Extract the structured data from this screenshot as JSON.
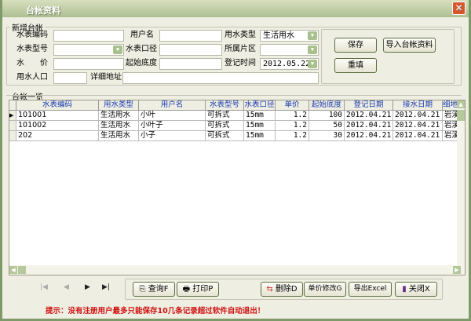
{
  "window": {
    "title": "台帐资料",
    "close": "✕"
  },
  "form": {
    "group_label": "新增台帐",
    "labels": {
      "meter_code": "水表编码",
      "username": "用户名",
      "water_type": "用水类型",
      "meter_model": "水表型号",
      "meter_caliber": "水表口径",
      "area": "所属片区",
      "price": "水　　价",
      "start_reading": "起始底度",
      "reg_time": "登记时间",
      "population": "用水人口",
      "address": "详细地址"
    },
    "values": {
      "meter_code": "",
      "username": "",
      "water_type": "生活用水",
      "meter_model": "",
      "meter_caliber": "",
      "area": "",
      "price": "",
      "start_reading": "",
      "reg_time": "2012.05.22",
      "population": "",
      "address": ""
    },
    "buttons": {
      "save": "保存",
      "import": "导入台帐资料",
      "reset": "重填"
    }
  },
  "table": {
    "group_label": "台帐一览",
    "columns": [
      "水表编码",
      "用水类型",
      "用户名",
      "水表型号",
      "水表口径",
      "单价",
      "起始底度",
      "登记日期",
      "接水日期",
      "细地"
    ],
    "rows": [
      [
        "101001",
        "生活用水",
        "小叶",
        "可拆式",
        "15mm",
        "1.2",
        "100",
        "2012.04.21",
        "2012.04.21",
        "岩溪"
      ],
      [
        "101002",
        "生活用水",
        "小叶子",
        "可拆式",
        "15mm",
        "1.2",
        "50",
        "2012.04.21",
        "2012.04.21",
        "岩溪"
      ],
      [
        "202",
        "生活用水",
        "小子",
        "可拆式",
        "15mm",
        "1.2",
        "30",
        "2012.04.21",
        "2012.04.21",
        "岩溪"
      ]
    ]
  },
  "toolbar": {
    "nav": {
      "first": "|◀",
      "prev": "◀",
      "next": "▶",
      "last": "▶|"
    },
    "query": "查询F",
    "print": "打印P",
    "delete": "删除D",
    "price_edit": "单价修改G",
    "export": "导出Excel",
    "close": "关闭X"
  },
  "hint": "提示：没有注册用户最多只能保存10几条记录超过软件自动退出！"
}
